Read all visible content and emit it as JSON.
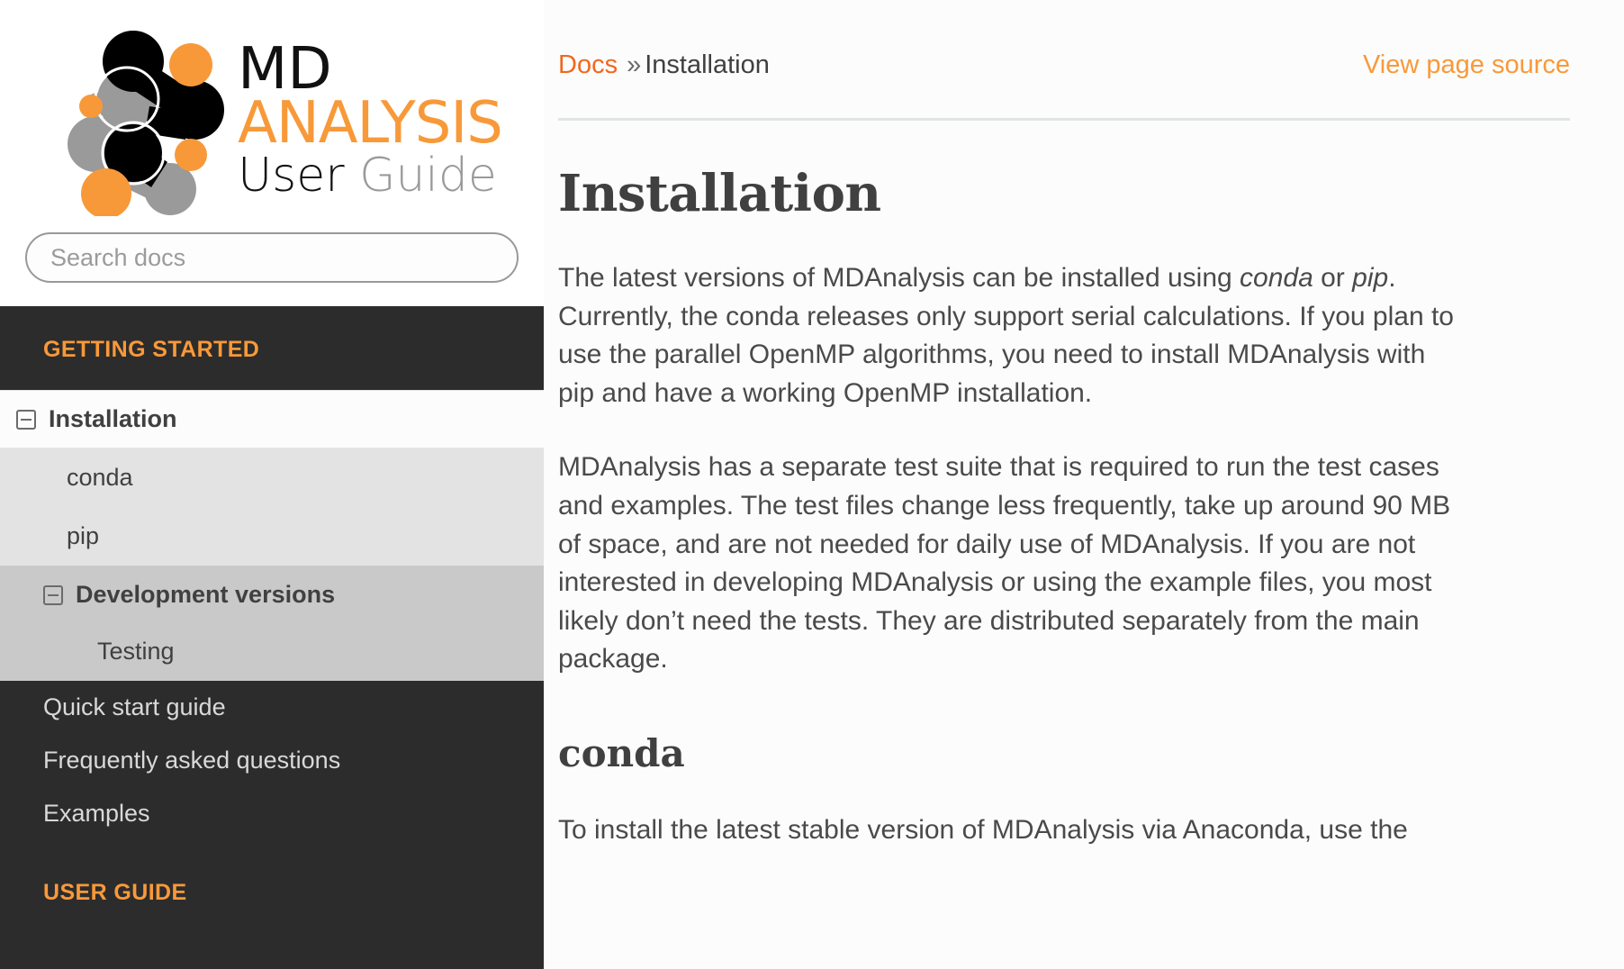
{
  "sidebar": {
    "logo": {
      "line1": "MD",
      "line2": "ANALYSIS",
      "line3_user": "User",
      "line3_guide": "Guide"
    },
    "search": {
      "placeholder": "Search docs",
      "value": ""
    },
    "captions": {
      "getting_started": "GETTING STARTED",
      "user_guide": "USER GUIDE"
    },
    "items": [
      {
        "label": "Installation",
        "level": 1,
        "state": "current",
        "icon": "minus-box-icon"
      },
      {
        "label": "conda",
        "level": 2,
        "state": "sub"
      },
      {
        "label": "pip",
        "level": 2,
        "state": "sub"
      },
      {
        "label": "Development versions",
        "level": 2,
        "state": "expanded",
        "icon": "minus-box-icon"
      },
      {
        "label": "Testing",
        "level": 3,
        "state": "sub3"
      },
      {
        "label": "Quick start guide",
        "level": 1,
        "state": "normal"
      },
      {
        "label": "Frequently asked questions",
        "level": 1,
        "state": "normal"
      },
      {
        "label": "Examples",
        "level": 1,
        "state": "normal"
      }
    ]
  },
  "header": {
    "breadcrumb_root": "Docs",
    "breadcrumb_sep": "»",
    "breadcrumb_current": "Installation",
    "view_page_source": "View page source"
  },
  "main": {
    "title": "Installation",
    "paragraph1": {
      "part1": "The latest versions of MDAnalysis can be installed using ",
      "em1": "conda",
      "part2": " or ",
      "em2": "pip",
      "part3": ". Currently, the conda releases only support serial calculations. If you plan to use the parallel OpenMP algorithms, you need to install MDAnalysis with pip and have a working OpenMP installation."
    },
    "paragraph2": "MDAnalysis has a separate test suite that is required to run the test cases and examples. The test files change less frequently, take up around 90 MB of space, and are not needed for daily use of MDAnalysis. If you are not interested in developing MDAnalysis or using the example files, you most likely don’t need the tests. They are distributed separately from the main package.",
    "section_conda_title": "conda",
    "paragraph3": "To install the latest stable version of MDAnalysis via Anaconda, use the"
  },
  "colors": {
    "accent_orange": "#f89939",
    "link_orange": "#f0681e",
    "sidebar_dark": "#2c2c2c",
    "sub_gray": "#e3e3e3",
    "sub2_gray": "#c9c9c9",
    "text_dark": "#404040",
    "rule": "#e1e4e5"
  }
}
